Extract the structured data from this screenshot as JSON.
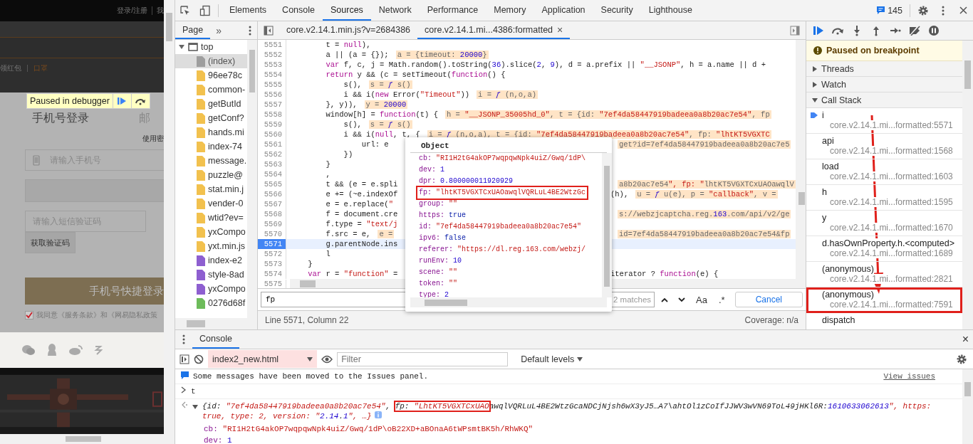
{
  "page_preview": {
    "top_links": [
      "登录/注册",
      "我"
    ],
    "nav_links": [
      {
        "label": "领红包",
        "selected": false
      },
      {
        "label": "口罩",
        "selected": true
      }
    ],
    "paused_banner": "Paused in debugger",
    "login": {
      "tabs": [
        {
          "label": "手机号登录",
          "selected": true
        },
        {
          "label": "邮",
          "selected": false
        }
      ],
      "password_link": "使用密",
      "phone_placeholder": "请输入手机号",
      "sms_placeholder": "请输入短信验证码",
      "get_code_button": "获取验证码",
      "submit_button": "手机号快捷登录",
      "agree": {
        "checked": true,
        "text": "我同意《服务条款》和《网易隐私政策"
      }
    }
  },
  "devtools": {
    "tabs": [
      {
        "label": "Elements",
        "selected": false
      },
      {
        "label": "Console",
        "selected": false
      },
      {
        "label": "Sources",
        "selected": true
      },
      {
        "label": "Network",
        "selected": false
      },
      {
        "label": "Performance",
        "selected": false
      },
      {
        "label": "Memory",
        "selected": false
      },
      {
        "label": "Application",
        "selected": false
      },
      {
        "label": "Security",
        "selected": false
      },
      {
        "label": "Lighthouse",
        "selected": false
      }
    ],
    "issues_count": "145",
    "navigator": {
      "tabs": [
        {
          "label": "Page",
          "selected": true
        }
      ],
      "more": "»",
      "tree": {
        "label": "top",
        "expanded": true,
        "children": [
          {
            "label": "(index)",
            "kind": "document",
            "selected": true
          },
          {
            "label": "96ee78c",
            "kind": "script",
            "selected": false
          },
          {
            "label": "common-",
            "kind": "script",
            "selected": false
          },
          {
            "label": "getButId",
            "kind": "script",
            "selected": false
          },
          {
            "label": "getConf?",
            "kind": "script",
            "selected": false
          },
          {
            "label": "hands.mi",
            "kind": "script",
            "selected": false
          },
          {
            "label": "index-74",
            "kind": "script",
            "selected": false
          },
          {
            "label": "message.",
            "kind": "script",
            "selected": false
          },
          {
            "label": "puzzle@",
            "kind": "script",
            "selected": false
          },
          {
            "label": "stat.min.j",
            "kind": "script",
            "selected": false
          },
          {
            "label": "vender-0",
            "kind": "script",
            "selected": false
          },
          {
            "label": "wtid?ev=",
            "kind": "script",
            "selected": false
          },
          {
            "label": "yxCompo",
            "kind": "script",
            "selected": false
          },
          {
            "label": "yxt.min.js",
            "kind": "script",
            "selected": false
          },
          {
            "label": "index-e2",
            "kind": "stylesheet",
            "selected": false
          },
          {
            "label": "style-8ad",
            "kind": "stylesheet",
            "selected": false
          },
          {
            "label": "yxCompo",
            "kind": "stylesheet",
            "selected": false
          },
          {
            "label": "0276d68f",
            "selected": false
          }
        ]
      }
    },
    "editor": {
      "tabs": [
        {
          "label": "core.v2.14.1.min.js?v=2684386",
          "selected": false
        },
        {
          "label": "core.v2.14.1.mi...4386:formatted",
          "selected": true,
          "close": "×"
        }
      ],
      "lines": [
        {
          "n": "5551",
          "code": "        t = null),",
          "current": false
        },
        {
          "n": "5552",
          "code": "        a || (a = {});",
          "value": "a = {timeout: 20000}",
          "current": false
        },
        {
          "n": "5553",
          "code": "        var f, c, j = Math.random().toString(36).slice(2, 9), d = a.prefix || \"__JSONP\", h = a.name || d +",
          "current": false
        },
        {
          "n": "5554",
          "code": "        return y && (c = setTimeout(function() {",
          "current": false
        },
        {
          "n": "5555",
          "code": "            s(),",
          "value": "s = ƒ s()",
          "current": false
        },
        {
          "n": "5556",
          "code": "            i && i(new Error(\"Timeout\"))",
          "value": "i = ƒ (n,o,a)",
          "current": false
        },
        {
          "n": "5557",
          "code": "        }, y)),",
          "value": "y = 20000",
          "current": false
        },
        {
          "n": "5558",
          "code": "        window[h] = function(t) {",
          "value": "h = \"__JSONP_35005hd_0\", t = {id: \"7ef4da58447919badeea0a8b20ac7e54\", fp",
          "current": false
        },
        {
          "n": "5559",
          "code": "            s(),",
          "value": "s = ƒ s()",
          "current": false
        },
        {
          "n": "5560",
          "code": "            i && i(null, t, {",
          "value": "i = ƒ (n,o,a), t = {id: \"7ef4da58447919badeea0a8b20ac7e54\", fp: \"lhtKT5VGXTC",
          "current": false
        },
        {
          "n": "5561",
          "code": "                url: e",
          "right_value": "get?id=7ef4da58447919badeea0a8b20ac7e5",
          "current": false
        },
        {
          "n": "5562",
          "code": "            })",
          "current": false
        },
        {
          "n": "5563",
          "code": "        }",
          "current": false
        },
        {
          "n": "5564",
          "code": "        ,",
          "current": false
        },
        {
          "n": "5565",
          "code": "        t && (e = e.spli",
          "right_value": "a8b20ac7e54\", fp: \"lhtKT5VGXTCxUAOawqlV",
          "current": false
        },
        {
          "n": "5566",
          "code": "        e += (~e.indexOf",
          "right_code": "(h),",
          "right_value": "u = ƒ u(e), p = \"callback\", v =",
          "current": false
        },
        {
          "n": "5567",
          "code": "        e = e.replace(\"",
          "current": false
        },
        {
          "n": "5568",
          "code": "        f = document.cre",
          "right_value": "s://webzjcaptcha.reg.163.com/api/v2/ge",
          "current": false
        },
        {
          "n": "5569",
          "code": "        f.type = \"text/j",
          "current": false
        },
        {
          "n": "5570",
          "code": "        f.src = e,",
          "value": "e =",
          "right_value": "id=7ef4da58447919badeea0a8b20ac7e54&fp",
          "current": false
        },
        {
          "n": "5571",
          "code": "        g.parentNode.ins",
          "current": true
        },
        {
          "n": "5572",
          "code": "        l",
          "current": false
        },
        {
          "n": "5573",
          "code": "    }",
          "current": false
        },
        {
          "n": "5574",
          "code": "    var r = \"function\" =",
          "right_code": "iterator ? function(e) {",
          "current": false
        }
      ],
      "last_line_number": "5575",
      "popup": {
        "title": "Object",
        "entries": [
          {
            "key": "cb:",
            "value": "\"RI1H2tG4akOP7wqpqwNpk4uiZ/Gwq/1dP\\",
            "kind": "string",
            "annotated": false
          },
          {
            "key": "dev:",
            "value": "1",
            "kind": "number",
            "annotated": false
          },
          {
            "key": "dpr:",
            "value": "0.800000011920929",
            "kind": "number",
            "annotated": false
          },
          {
            "key": "fp:",
            "value": "\"lhtKT5VGXTCxUAOawqlVQRLuL4BE2WtzGc",
            "kind": "string",
            "annotated": true
          },
          {
            "key": "group:",
            "value": "\"\"",
            "kind": "string",
            "annotated": false
          },
          {
            "key": "https:",
            "value": "true",
            "kind": "bool",
            "annotated": false
          },
          {
            "key": "id:",
            "value": "\"7ef4da58447919badeea0a8b20ac7e54\"",
            "kind": "string",
            "annotated": false
          },
          {
            "key": "ipv6:",
            "value": "false",
            "kind": "bool",
            "annotated": false
          },
          {
            "key": "referer:",
            "value": "\"https://dl.reg.163.com/webzj/",
            "kind": "string",
            "annotated": false
          },
          {
            "key": "runEnv:",
            "value": "10",
            "kind": "number",
            "annotated": false
          },
          {
            "key": "scene:",
            "value": "\"\"",
            "kind": "string",
            "annotated": false
          },
          {
            "key": "token:",
            "value": "\"\"",
            "kind": "string",
            "annotated": false
          },
          {
            "key": "type:",
            "value": "2",
            "kind": "number",
            "annotated": false
          }
        ]
      },
      "search": {
        "value": "fp",
        "matches": "2 matches",
        "case": "Aa",
        "regex": ".*",
        "cancel": "Cancel"
      },
      "status": {
        "position": "Line 5571, Column 22",
        "coverage": "Coverage: n/a"
      }
    },
    "debugger": {
      "banner": "Paused on breakpoint",
      "sections": [
        {
          "label": "Threads",
          "expanded": false
        },
        {
          "label": "Watch",
          "expanded": false
        },
        {
          "label": "Call Stack",
          "expanded": true
        }
      ],
      "annotation_arrow": true,
      "call_stack": [
        {
          "name": "i",
          "location": "core.v2.14.1.mi...formatted:5571",
          "current": true,
          "annotated": false
        },
        {
          "name": "api",
          "location": "core.v2.14.1.mi...formatted:1568",
          "current": false,
          "annotated": false
        },
        {
          "name": "load",
          "location": "core.v2.14.1.mi...formatted:1603",
          "current": false,
          "annotated": false
        },
        {
          "name": "h",
          "location": "core.v2.14.1.mi...formatted:1595",
          "current": false,
          "annotated": false
        },
        {
          "name": "y",
          "location": "core.v2.14.1.mi...formatted:1670",
          "current": false,
          "annotated": false
        },
        {
          "name": "d.hasOwnProperty.h.<computed>",
          "location": "core.v2.14.1.mi...formatted:1689",
          "current": false,
          "annotated": false
        },
        {
          "name": "(anonymous)",
          "location": "core.v2.14.1.mi...formatted:2821",
          "current": false,
          "annotated": false
        },
        {
          "name": "(anonymous)",
          "location": "core.v2.14.1.mi...formatted:7591",
          "current": false,
          "annotated": true
        },
        {
          "name": "dispatch",
          "current": false,
          "annotated": false
        }
      ]
    },
    "drawer": {
      "tabs": [
        {
          "label": "Console",
          "selected": true
        }
      ],
      "close": "×",
      "context": "index2_new.html",
      "filter_placeholder": "Filter",
      "levels": "Default levels",
      "messages": [
        {
          "kind": "info",
          "text": "Some messages have been moved to the Issues panel.",
          "link": "View issues"
        },
        {
          "kind": "input",
          "text": "t"
        },
        {
          "kind": "result",
          "expanded": true,
          "parts": [
            {
              "text": "{id: \"7ef4da58447919badeea0a8b20ac7e54\", ",
              "annotated": false
            },
            {
              "text": "fp: \"LhtKT5VGXTCxUAO",
              "annotated": true
            },
            {
              "text": "awqlVQRLuL4BE2WtzGcaNDCjNjsh6wX3yJ5…A7\\ahtOl1zCoIfJJWV3wVN69ToL49jHKl6R:1610633062613\", https: true, type: 2, version: \"2.14.1\", …}",
              "annotated": false
            }
          ]
        },
        {
          "kind": "property",
          "text": "cb: \"RI1H2tG4akOP7wqpqwNpk4uiZ/Gwq/1dP\\oB22XD+aBOnaA6tWPsmtBK5h/RhWKQ\""
        },
        {
          "kind": "property",
          "text": "dev: 1"
        }
      ]
    }
  }
}
